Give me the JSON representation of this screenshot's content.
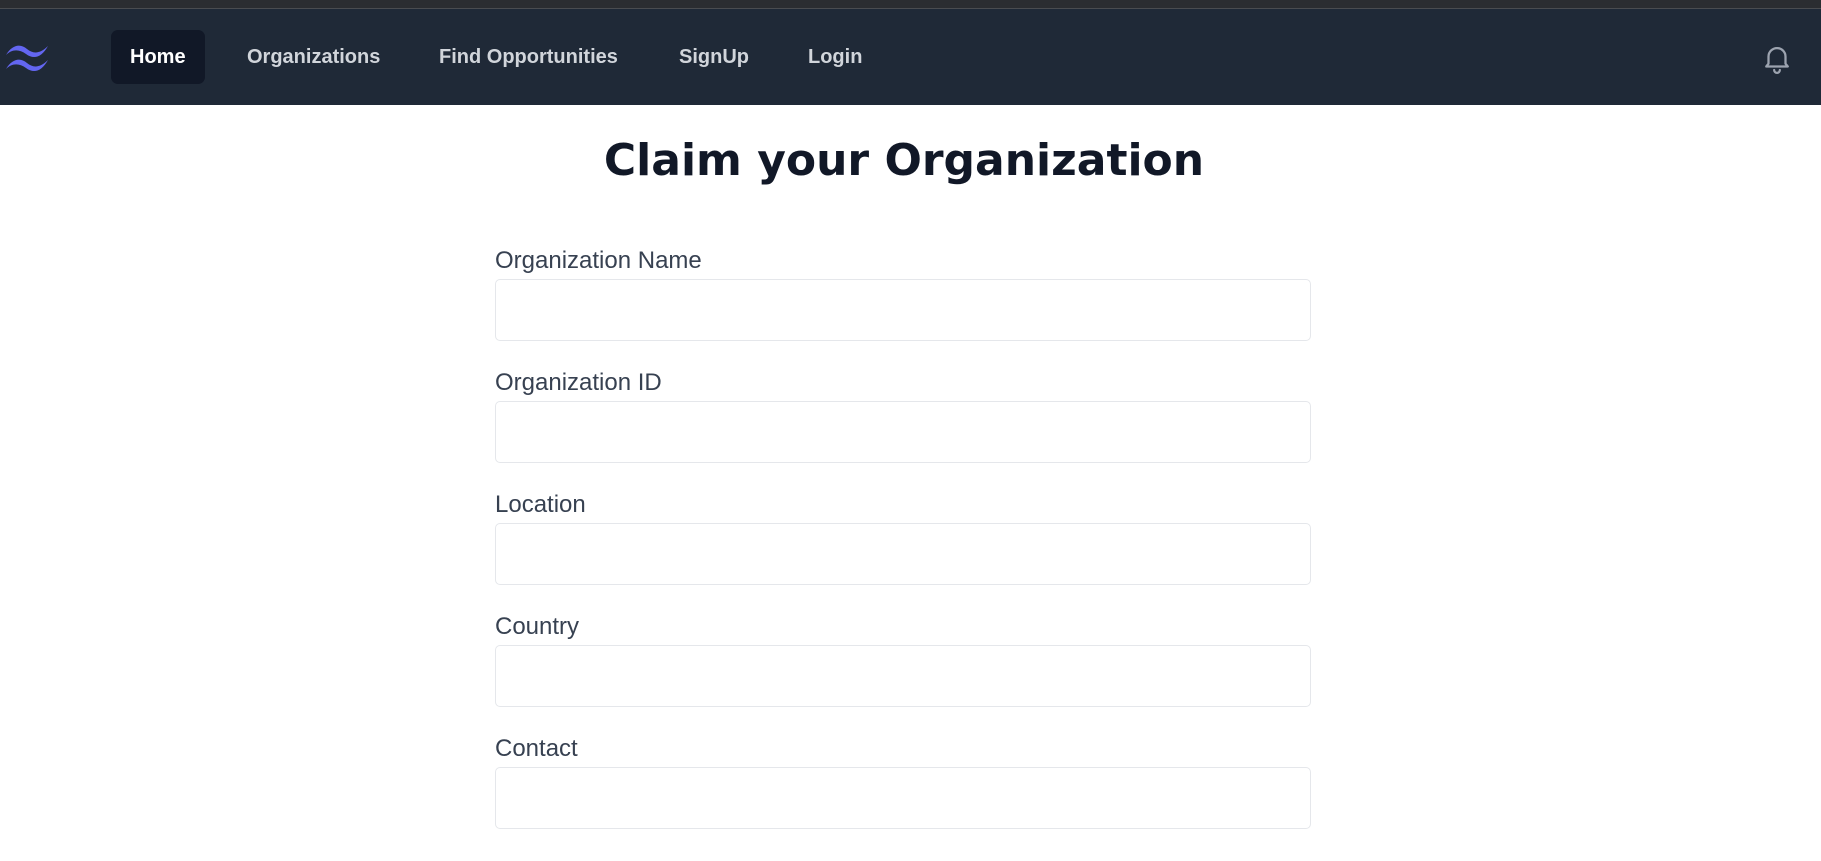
{
  "nav": {
    "items": [
      {
        "label": "Home",
        "active": true
      },
      {
        "label": "Organizations",
        "active": false
      },
      {
        "label": "Find Opportunities",
        "active": false
      },
      {
        "label": "SignUp",
        "active": false
      },
      {
        "label": "Login",
        "active": false
      }
    ],
    "logo_icon": "tailwind-wave-logo",
    "notification_icon": "bell-icon"
  },
  "page": {
    "title": "Claim your Organization"
  },
  "form": {
    "fields": [
      {
        "label": "Organization Name",
        "value": "",
        "placeholder": ""
      },
      {
        "label": "Organization ID",
        "value": "",
        "placeholder": ""
      },
      {
        "label": "Location",
        "value": "",
        "placeholder": ""
      },
      {
        "label": "Country",
        "value": "",
        "placeholder": ""
      },
      {
        "label": "Contact",
        "value": "",
        "placeholder": ""
      }
    ]
  },
  "colors": {
    "navbar_bg": "#1f2937",
    "nav_active_bg": "#111827",
    "nav_text": "#d1d5db",
    "logo_accent": "#6366f1",
    "title_text": "#111827",
    "label_text": "#374151",
    "input_border": "#e5e7eb"
  }
}
